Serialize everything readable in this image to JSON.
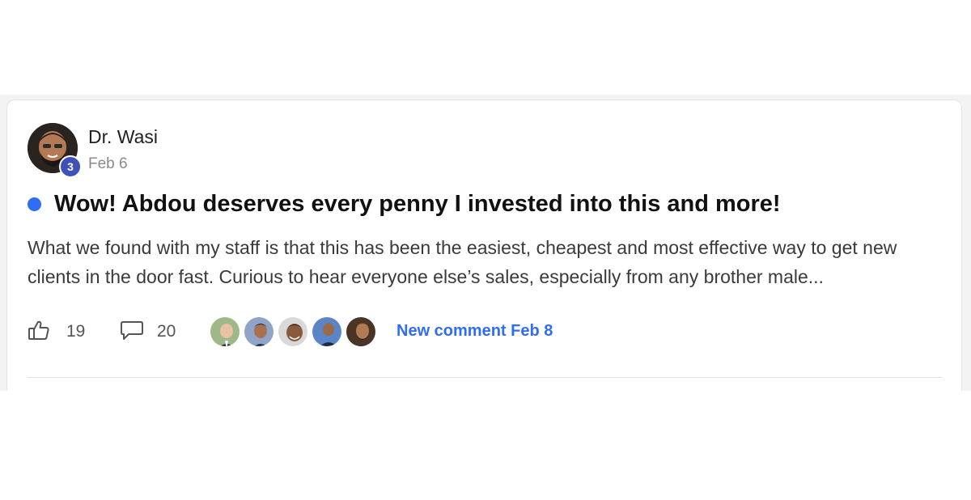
{
  "post": {
    "author": {
      "name": "Dr. Wasi",
      "level": "3",
      "date": "Feb 6"
    },
    "title": "Wow! Abdou deserves every penny I invested into this and more!",
    "body": "What we found with my staff is that this has been the easiest, cheapest and most effective way to get new clients in the door fast. Curious to hear everyone else’s sales, especially from any brother male...",
    "likes": "19",
    "comments": "20",
    "new_comment_label": "New comment Feb 8",
    "commenter_count": 5
  },
  "colors": {
    "accent": "#2f6df6",
    "level_badge": "#3f51b5",
    "background_band": "#f3f3f3"
  },
  "icons": {
    "like": "thumbs-up-icon",
    "comment": "speech-bubble-icon",
    "unread": "unread-dot"
  }
}
